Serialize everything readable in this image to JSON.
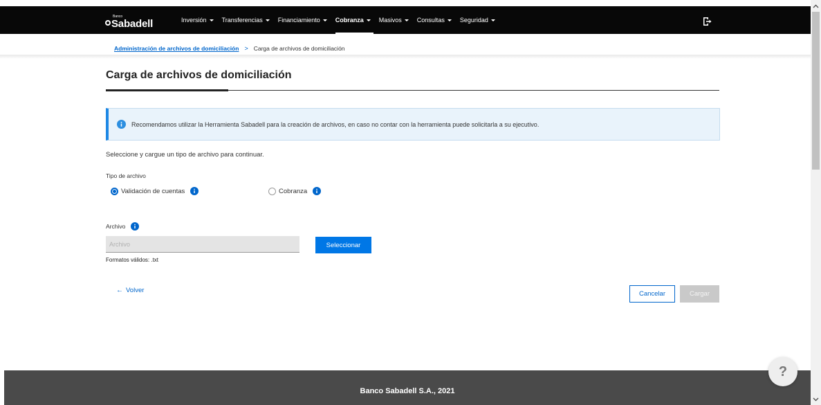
{
  "brand": {
    "small_text": "Banco",
    "name": "Sabadell"
  },
  "nav": {
    "items": [
      {
        "label": "Inversión",
        "active": false
      },
      {
        "label": "Transferencias",
        "active": false
      },
      {
        "label": "Financiamiento",
        "active": false
      },
      {
        "label": "Cobranza",
        "active": true
      },
      {
        "label": "Masivos",
        "active": false
      },
      {
        "label": "Consultas",
        "active": false
      },
      {
        "label": "Seguridad",
        "active": false
      }
    ],
    "exit_icon": "logout-icon"
  },
  "breadcrumb": {
    "parent": "Administración de archivos de domiciliación",
    "separator": ">",
    "current": "Carga de archivos de domiciliación"
  },
  "page": {
    "title": "Carga de archivos de domiciliación",
    "alert_text": "Recomendamos utilizar la Herramienta Sabadell para la creación de archivos, en caso no contar con la herramienta puede solicitarla a su ejecutivo.",
    "instruction": "Seleccione y cargue un tipo de archivo para continuar.",
    "file_type_label": "Tipo de archivo",
    "options": [
      {
        "label": "Validación de cuentas",
        "checked": true
      },
      {
        "label": "Cobranza",
        "checked": false
      }
    ],
    "file_label": "Archivo",
    "file_placeholder": "Archivo",
    "select_button": "Seleccionar",
    "formats": "Formatos válidos: .txt",
    "back_label": "Volver",
    "cancel_button": "Cancelar",
    "submit_button": "Cargar"
  },
  "help_label": "?",
  "footer": {
    "text": "Banco Sabadell S.A., 2021"
  },
  "colors": {
    "primary": "#0077e6",
    "link": "#0066cc",
    "topbar": "#080808",
    "footer": "#4a4a4a",
    "alert_bg": "#e9f3fb"
  }
}
